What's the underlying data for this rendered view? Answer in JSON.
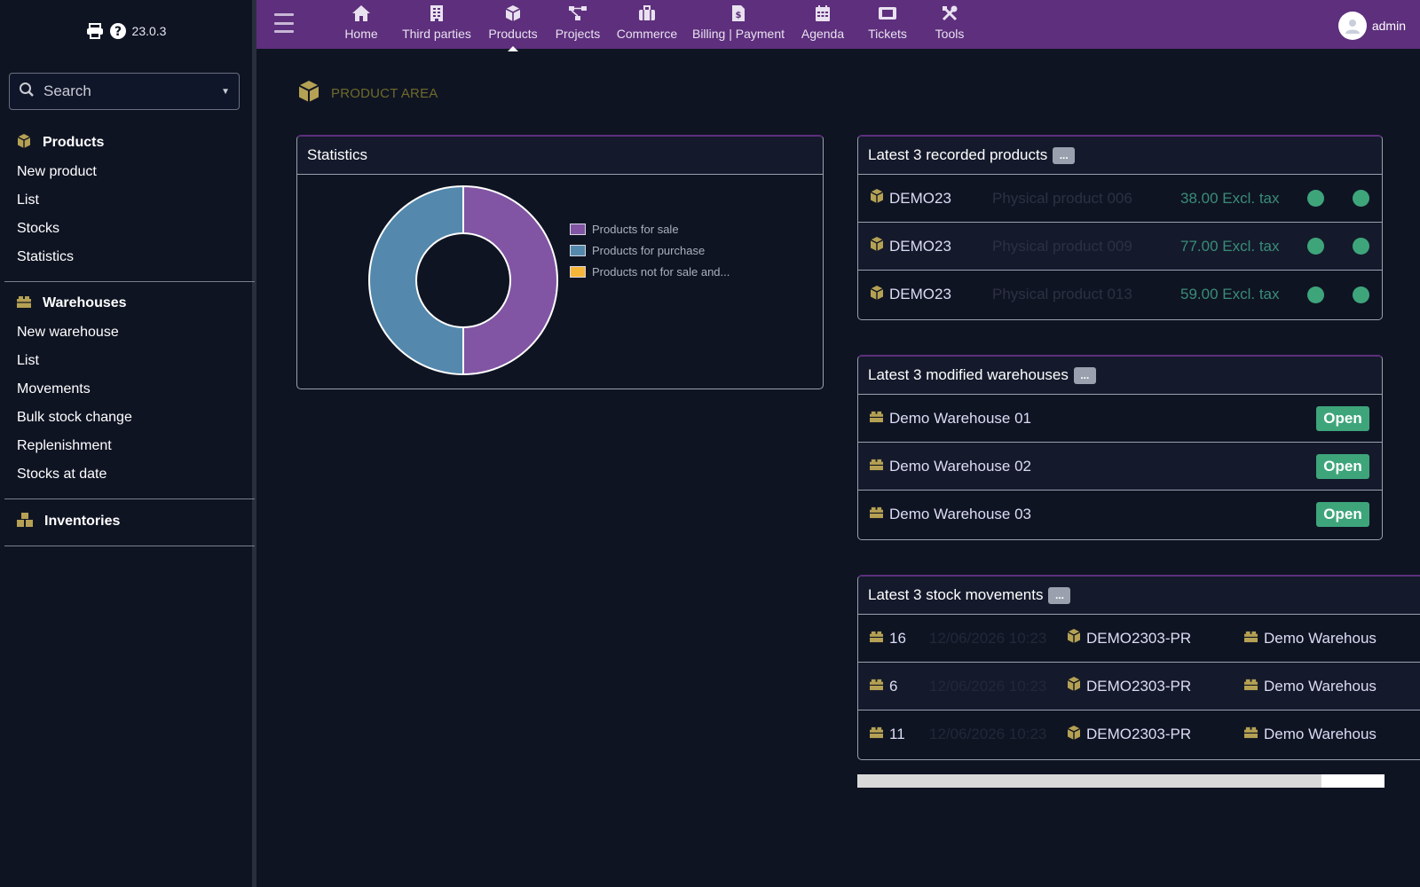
{
  "app": {
    "version": "23.0.3"
  },
  "search": {
    "placeholder": "Search"
  },
  "sidebar": {
    "products": {
      "heading": "Products",
      "items": [
        "New product",
        "List",
        "Stocks",
        "Statistics"
      ]
    },
    "warehouses": {
      "heading": "Warehouses",
      "items": [
        "New warehouse",
        "List",
        "Movements",
        "Bulk stock change",
        "Replenishment",
        "Stocks at date"
      ]
    },
    "inventories": {
      "heading": "Inventories"
    }
  },
  "topnav": {
    "items": [
      {
        "label": "Home",
        "icon": "home-icon"
      },
      {
        "label": "Third parties",
        "icon": "building-icon"
      },
      {
        "label": "Products",
        "icon": "cube-icon",
        "active": true
      },
      {
        "label": "Projects",
        "icon": "project-icon"
      },
      {
        "label": "Commerce",
        "icon": "briefcase-icon"
      },
      {
        "label": "Billing | Payment",
        "icon": "invoice-icon"
      },
      {
        "label": "Agenda",
        "icon": "calendar-icon"
      },
      {
        "label": "Tickets",
        "icon": "ticket-icon"
      },
      {
        "label": "Tools",
        "icon": "tools-icon"
      }
    ],
    "user": "admin"
  },
  "main": {
    "area_title": "PRODUCT AREA",
    "statistics": {
      "title": "Statistics"
    },
    "latest_products": {
      "title": "Latest 3 recorded products",
      "more": "...",
      "rows": [
        {
          "ref": "DEMO23",
          "label": "Physical product 006",
          "price": "38.00 Excl. tax"
        },
        {
          "ref": "DEMO23",
          "label": "Physical product 009",
          "price": "77.00 Excl. tax"
        },
        {
          "ref": "DEMO23",
          "label": "Physical product 013",
          "price": "59.00 Excl. tax"
        }
      ]
    },
    "latest_warehouses": {
      "title": "Latest 3 modified warehouses",
      "more": "...",
      "rows": [
        {
          "name": "Demo Warehouse 01",
          "status": "Open"
        },
        {
          "name": "Demo Warehouse 02",
          "status": "Open"
        },
        {
          "name": "Demo Warehouse 03",
          "status": "Open"
        }
      ]
    },
    "latest_movements": {
      "title": "Latest 3 stock movements",
      "more": "...",
      "rows": [
        {
          "id": "16",
          "date": "12/06/2026 10:23",
          "product": "DEMO2303-PR",
          "warehouse": "Demo Warehous"
        },
        {
          "id": "6",
          "date": "12/06/2026 10:23",
          "product": "DEMO2303-PR",
          "warehouse": "Demo Warehous"
        },
        {
          "id": "11",
          "date": "12/06/2026 10:23",
          "product": "DEMO2303-PR",
          "warehouse": "Demo Warehous"
        }
      ]
    },
    "scroll_position": 0.88
  },
  "colors": {
    "topbar": "#5d2f7c",
    "status_green": "#3ea57b",
    "product_icon": "#b5a153"
  },
  "chart_data": {
    "type": "pie",
    "categories": [
      "Products for sale",
      "Products for purchase",
      "Products not for sale and..."
    ],
    "values": [
      50,
      50,
      0
    ],
    "colors": [
      "#8155a3",
      "#5489ad",
      "#f5b63a"
    ],
    "donut": true,
    "legend": "right"
  }
}
